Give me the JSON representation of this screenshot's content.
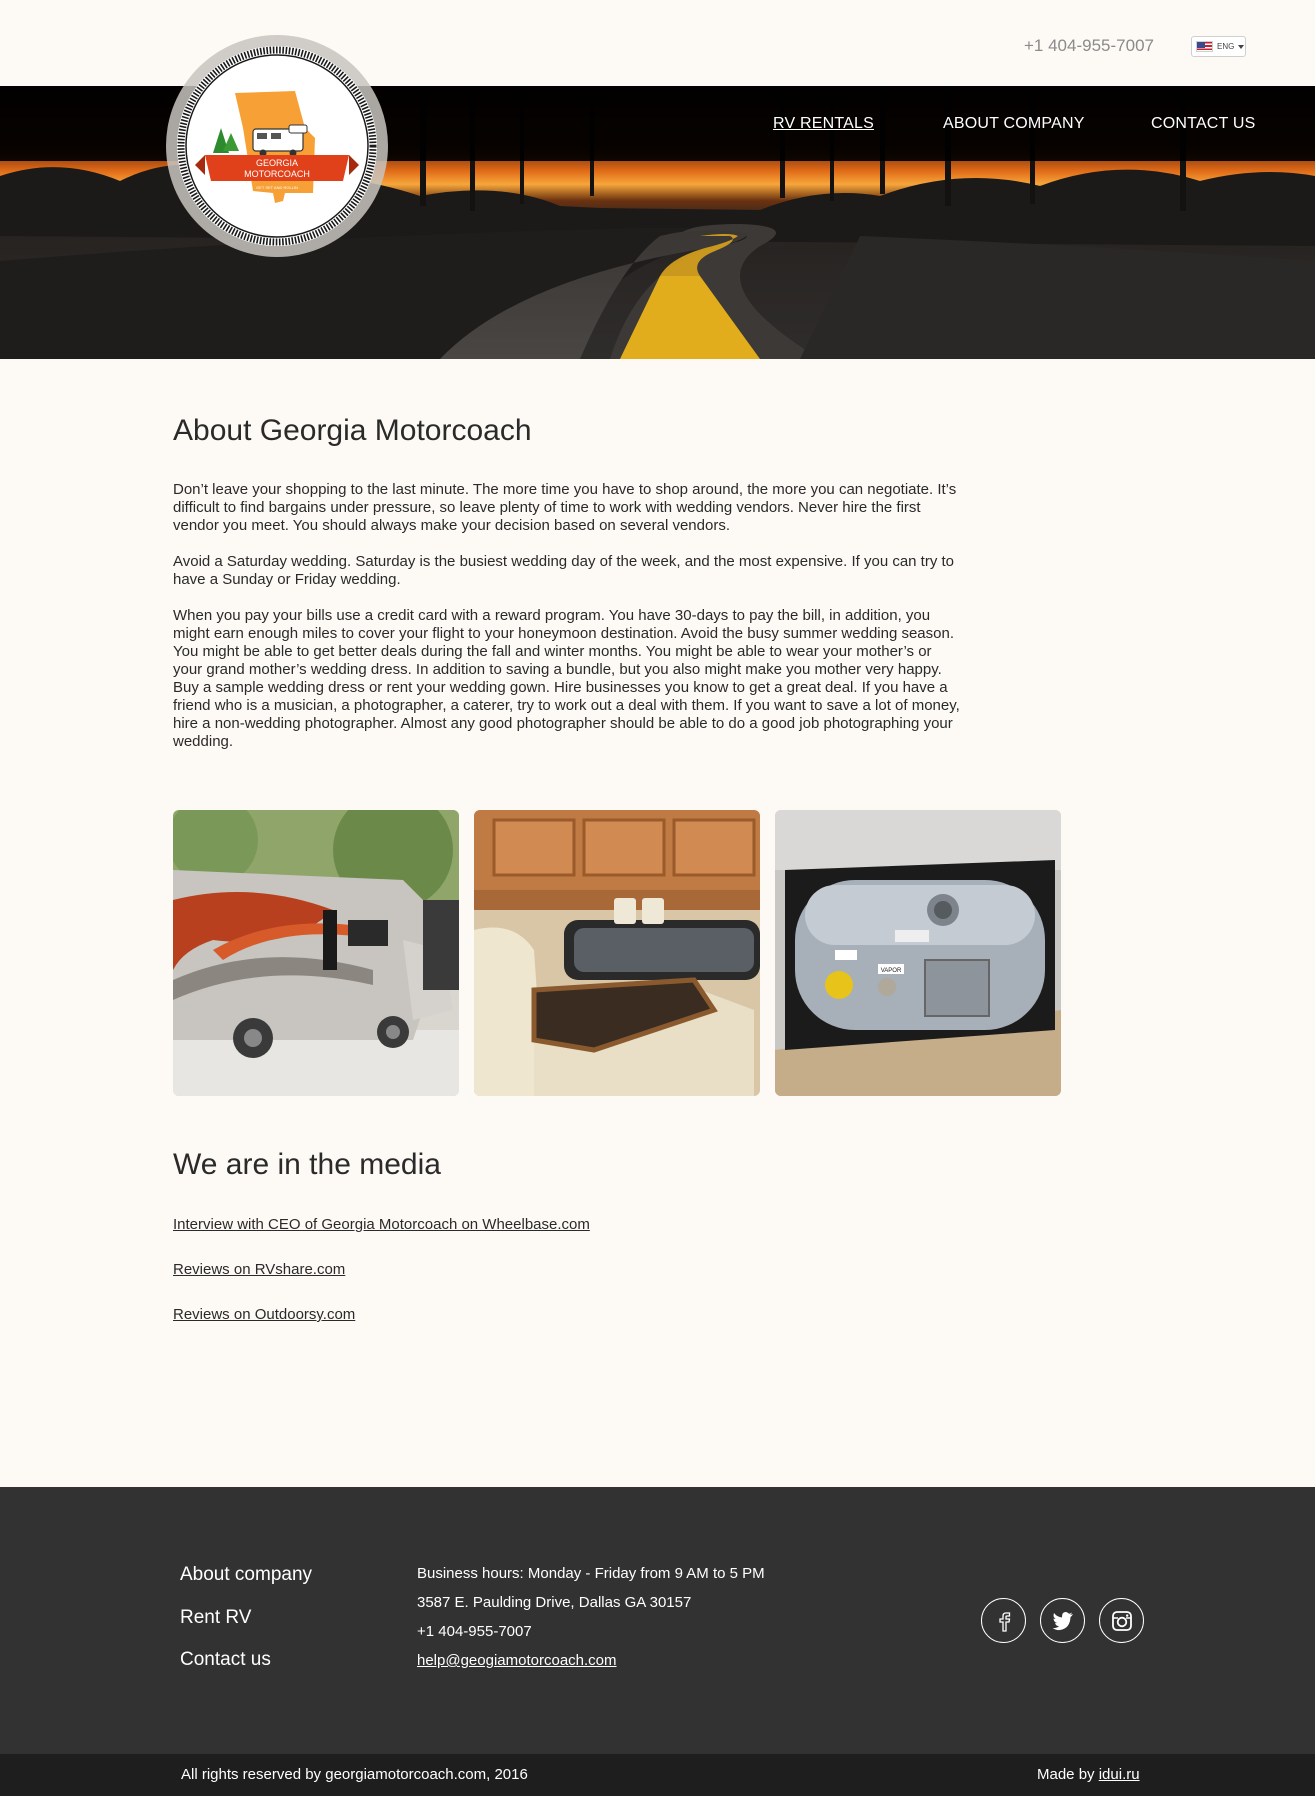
{
  "header": {
    "phone": "+1 404-955-7007",
    "language": "ENG",
    "nav": [
      {
        "label": "RV RENTALS",
        "active": true
      },
      {
        "label": "ABOUT COMPANY",
        "active": false
      },
      {
        "label": "CONTACT US",
        "active": false
      }
    ],
    "logo": {
      "line1": "GEORGIA",
      "line2": "MOTORCOACH",
      "tagline": "GET SET AND ROLLIN"
    }
  },
  "about": {
    "title": "About Georgia Motorcoach",
    "paragraphs": [
      "Don’t leave your shopping to the last minute. The more time you have to shop around, the more you can negotiate. It’s difficult to find bargains under pressure, so leave plenty of time to work with wedding vendors. Never hire the first vendor you meet. You should always make your decision based on several vendors.",
      "Avoid a Saturday wedding. Saturday is the busiest wedding day of the week, and the most expensive. If you can try to have a Sunday or Friday wedding.",
      "When you pay your bills use a credit card with a reward program. You have 30-days to pay the bill, in addition, you might earn enough miles to cover your flight to your honeymoon destination. Avoid the busy summer wedding season. You might be able to get better deals during the fall and winter months. You might be able to wear your mother’s or your grand mother’s wedding dress. In addition to saving a bundle, but you also might make you mother very happy. Buy a sample wedding dress or rent your wedding gown. Hire businesses you know to get a great deal. If you have a friend who is a musician, a photographer, a caterer, try to work out a deal with them. If you want to save a lot of money, hire a non-wedding photographer. Almost any good photographer should be able to do a good job photographing your wedding."
    ]
  },
  "photos": {
    "vapor_label": "VAPOR"
  },
  "media": {
    "title": "We are in the media",
    "links": [
      "Interview with CEO of Georgia Motorcoach on Wheelbase.com",
      "Reviews on RVshare.com",
      "Reviews on Outdoorsy.com"
    ]
  },
  "footer": {
    "nav": [
      "About company",
      "Rent RV",
      "Contact us"
    ],
    "hours": "Business hours: Monday - Friday from 9 AM to 5 PM",
    "address": "3587 E. Paulding Drive, Dallas GA 30157",
    "phone": "+1 404-955-7007",
    "email": "help@geogiamotorcoach.com",
    "social": [
      "facebook-icon",
      "twitter-icon",
      "instagram-icon"
    ],
    "copyright": "All rights reserved by georgiamotorcoach.com, 2016",
    "made_by_prefix": "Made by",
    "made_by_link": "idui.ru"
  },
  "colors": {
    "page_bg": "#fdfaf6",
    "footer_bg": "#323232",
    "bottom_bg": "#1e1e1e",
    "logo_orange": "#f7a035",
    "logo_red": "#e0401a"
  }
}
